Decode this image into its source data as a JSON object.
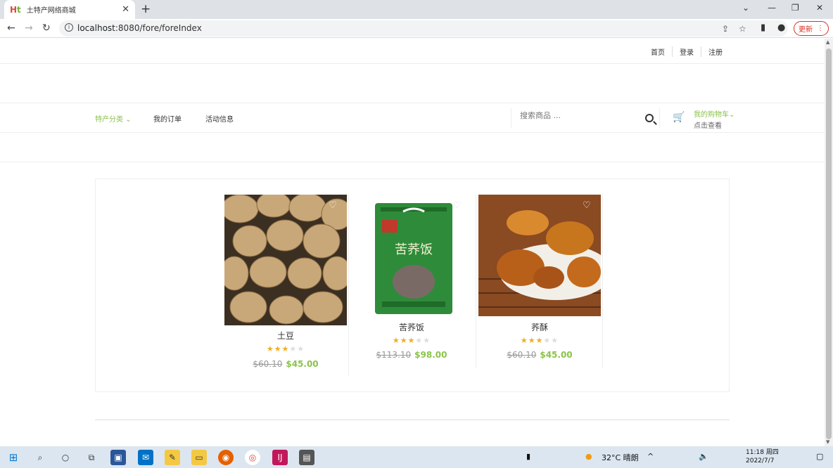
{
  "browser": {
    "tab_title": "土特产网络商城",
    "url_host": "localhost",
    "url_rest": ":8080/fore/foreIndex",
    "update_label": "更新"
  },
  "topnav": {
    "links": [
      "首页",
      "登录",
      "注册"
    ]
  },
  "menu": {
    "category_label": "特产分类",
    "items": [
      "我的订单",
      "活动信息"
    ],
    "search_placeholder": "搜索商品 ...",
    "cart_title": "我的购物车",
    "cart_sub": "点击查看"
  },
  "products": [
    {
      "name": "土豆",
      "rating": 3,
      "max_rating": 5,
      "old_price": "$60.10",
      "new_price": "$45.00"
    },
    {
      "name": "苦荞饭",
      "rating": 3,
      "max_rating": 5,
      "old_price": "$113.10",
      "new_price": "$98.00"
    },
    {
      "name": "荞酥",
      "rating": 3,
      "max_rating": 5,
      "old_price": "$60.10",
      "new_price": "$45.00"
    }
  ],
  "taskbar": {
    "weather": "32°C 晴朗",
    "time": "11:18 周四",
    "date": "2022/7/7"
  },
  "colors": {
    "accent_green": "#8bc34a",
    "star_gold": "#f0ad25",
    "update_red": "#d93025"
  }
}
